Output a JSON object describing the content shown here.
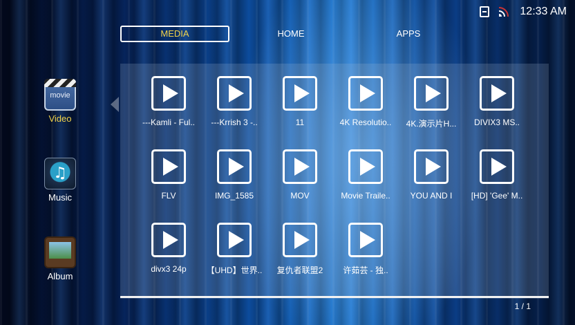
{
  "status": {
    "time": "12:33 AM",
    "icons": [
      "usb-icon",
      "wifi-icon"
    ]
  },
  "nav": {
    "tabs": [
      {
        "label": "MEDIA",
        "active": true
      },
      {
        "label": "HOME"
      },
      {
        "label": "APPS"
      }
    ]
  },
  "sidebar": {
    "items": [
      {
        "label": "Video",
        "icon": "movie-icon",
        "icon_text": "movie",
        "active": true
      },
      {
        "label": "Music",
        "icon": "music-icon"
      },
      {
        "label": "Album",
        "icon": "album-icon"
      }
    ]
  },
  "videos": [
    {
      "label": "---Kamli - Ful.."
    },
    {
      "label": "---Krrish 3 -.."
    },
    {
      "label": "11"
    },
    {
      "label": "4K Resolutio.."
    },
    {
      "label": "4K.演示片H..."
    },
    {
      "label": "DIVIX3 MS.."
    },
    {
      "label": "FLV"
    },
    {
      "label": "IMG_1585"
    },
    {
      "label": "MOV"
    },
    {
      "label": "Movie Traile.."
    },
    {
      "label": "YOU AND I"
    },
    {
      "label": "[HD] 'Gee' M.."
    },
    {
      "label": "divx3 24p"
    },
    {
      "label": "【UHD】世界.."
    },
    {
      "label": "复仇者联盟2"
    },
    {
      "label": "许茹芸 - 独.."
    }
  ],
  "pager": {
    "text": "1 / 1"
  },
  "colors": {
    "accent": "#f0d24a",
    "text": "#ffffff"
  }
}
